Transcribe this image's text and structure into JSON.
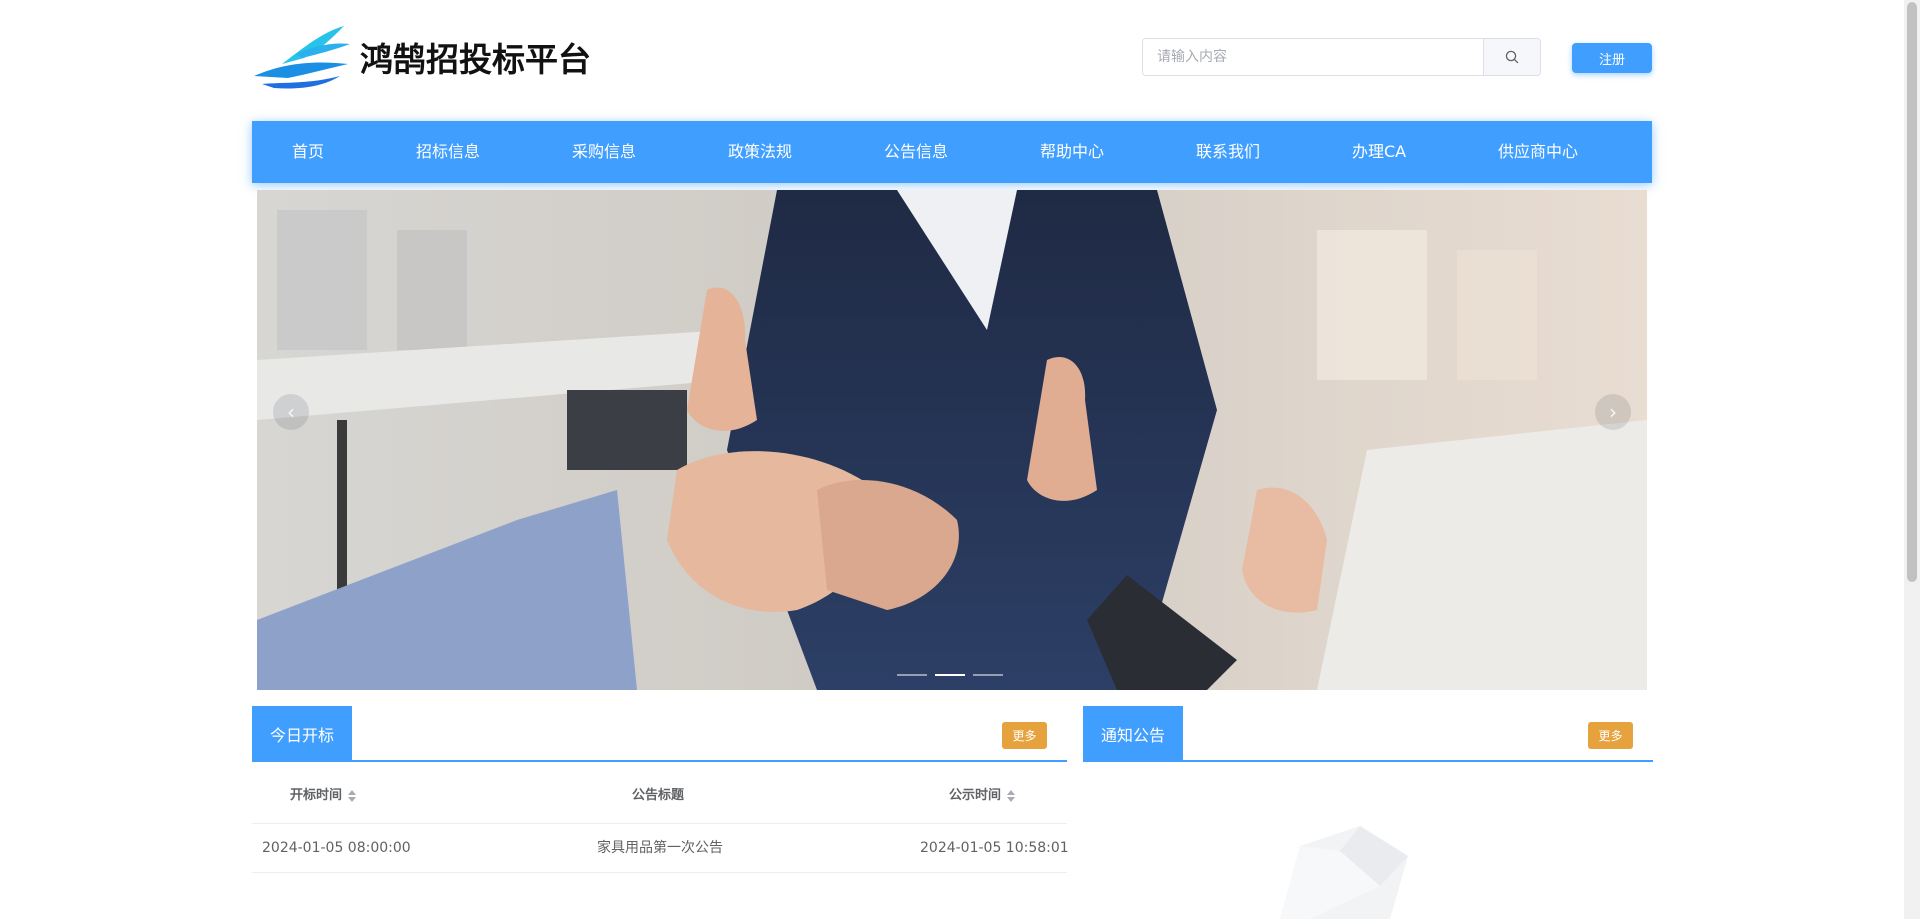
{
  "brand": {
    "name": "鸿鹄招投标平台",
    "logo_icon": "bird-wing-logo",
    "accent": "#409eff"
  },
  "search": {
    "placeholder": "请输入内容",
    "value": "",
    "icon": "search-icon"
  },
  "header": {
    "register_label": "注册"
  },
  "nav": {
    "items": [
      {
        "label": "首页"
      },
      {
        "label": "招标信息"
      },
      {
        "label": "采购信息"
      },
      {
        "label": "政策法规"
      },
      {
        "label": "公告信息"
      },
      {
        "label": "帮助中心"
      },
      {
        "label": "联系我们"
      },
      {
        "label": "办理CA"
      },
      {
        "label": "供应商中心"
      }
    ]
  },
  "carousel": {
    "prev_icon": "chevron-left-icon",
    "next_icon": "chevron-right-icon",
    "prev_glyph": "‹",
    "next_glyph": "›",
    "slide_count": 3,
    "active_index": 1
  },
  "today_opening": {
    "tab_label": "今日开标",
    "more_label": "更多",
    "columns": [
      "开标时间",
      "公告标题",
      "公示时间"
    ],
    "rows": [
      {
        "open_time": "2024-01-05 08:00:00",
        "title": "家具用品第一次公告",
        "publish_time": "2024-01-05 10:58:01"
      }
    ]
  },
  "notices": {
    "tab_label": "通知公告",
    "more_label": "更多",
    "rows": []
  },
  "colors": {
    "primary": "#409eff",
    "warning": "#e6a23c",
    "border": "#ebeef5",
    "text": "#606266"
  }
}
